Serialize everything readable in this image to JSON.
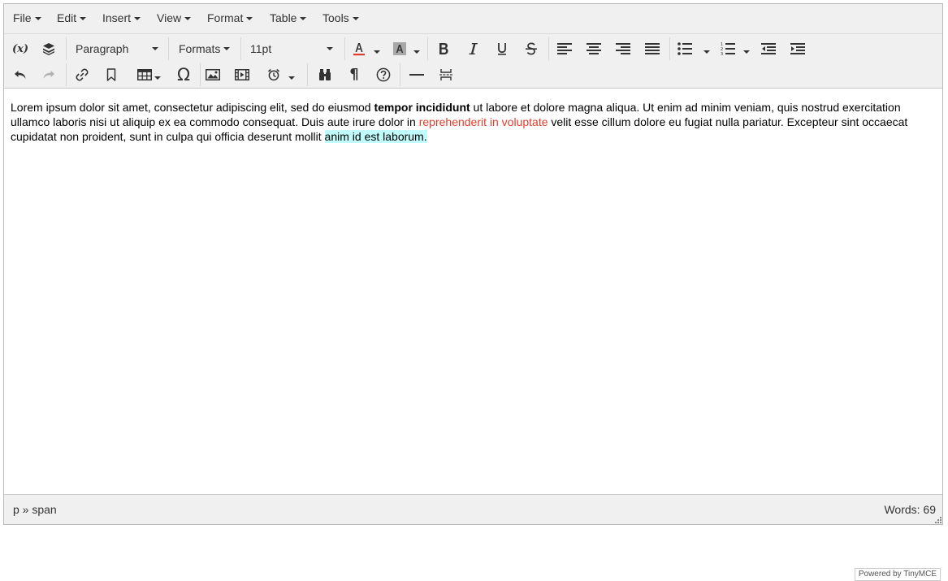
{
  "menubar": {
    "file": "File",
    "edit": "Edit",
    "insert": "Insert",
    "view": "View",
    "format": "Format",
    "table": "Table",
    "tools": "Tools"
  },
  "toolbar": {
    "variable_label": "(x)",
    "block_format": "Paragraph",
    "formats": "Formats",
    "font_size": "11pt",
    "text_color": "#e03e2d",
    "icons_row1": [
      "variable-icon",
      "template-icon",
      "text-color-icon",
      "background-color-icon",
      "bold-icon",
      "italic-icon",
      "underline-icon",
      "strikethrough-icon",
      "align-left-icon",
      "align-center-icon",
      "align-right-icon",
      "justify-icon",
      "bullet-list-icon",
      "numbered-list-icon",
      "outdent-icon",
      "indent-icon"
    ],
    "icons_row2": [
      "undo-icon",
      "redo-icon",
      "link-icon",
      "bookmark-icon",
      "table-icon",
      "special-char-icon",
      "image-icon",
      "media-icon",
      "clock-icon",
      "find-replace-icon",
      "paragraph-mark-icon",
      "help-icon",
      "horizontal-rule-icon",
      "page-break-icon"
    ]
  },
  "content": {
    "part1": "Lorem ipsum dolor sit amet, consectetur adipiscing elit, sed do eiusmod ",
    "bold": "tempor incididunt",
    "part2": " ut labore et dolore magna aliqua. Ut enim ad minim veniam, quis nostrud exercitation ullamco laboris nisi ut aliquip ex ea commodo consequat. Duis aute irure dolor in ",
    "red": "reprehenderit in voluptate",
    "part3": " velit esse cillum dolore eu fugiat nulla pariatur. Excepteur sint occaecat cupidatat non proident, sunt in culpa qui officia deserunt mollit ",
    "highlight": "anim id est laborum.",
    "highlight_color": "#bffcfb"
  },
  "branding": "Powered by TinyMCE",
  "statusbar": {
    "path": "p » span",
    "words": "Words: 69"
  }
}
